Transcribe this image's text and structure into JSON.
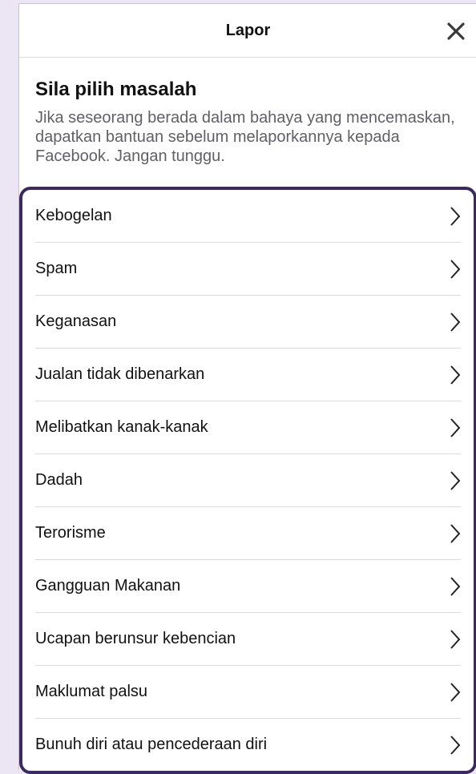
{
  "header": {
    "title": "Lapor",
    "close_icon": "close-icon"
  },
  "intro": {
    "title": "Sila pilih masalah",
    "description": "Jika seseorang berada dalam bahaya yang mencemaskan, dapatkan bantuan sebelum melaporkannya kepada Facebook. Jangan tunggu."
  },
  "problems": [
    {
      "label": "Kebogelan",
      "icon": "chevron-right-icon"
    },
    {
      "label": "Spam",
      "icon": "chevron-right-icon"
    },
    {
      "label": "Keganasan",
      "icon": "chevron-right-icon"
    },
    {
      "label": "Jualan tidak dibenarkan",
      "icon": "chevron-right-icon"
    },
    {
      "label": "Melibatkan kanak-kanak",
      "icon": "chevron-right-icon"
    },
    {
      "label": "Dadah",
      "icon": "chevron-right-icon"
    },
    {
      "label": "Terorisme",
      "icon": "chevron-right-icon"
    },
    {
      "label": "Gangguan Makanan",
      "icon": "chevron-right-icon"
    },
    {
      "label": "Ucapan berunsur kebencian",
      "icon": "chevron-right-icon"
    },
    {
      "label": "Maklumat palsu",
      "icon": "chevron-right-icon"
    },
    {
      "label": "Bunuh diri atau pencederaan diri",
      "icon": "chevron-right-icon"
    }
  ],
  "colors": {
    "background": "#ece6f4",
    "focus_border": "#3c2a5f",
    "text_primary": "#111111",
    "text_secondary": "#606066"
  }
}
